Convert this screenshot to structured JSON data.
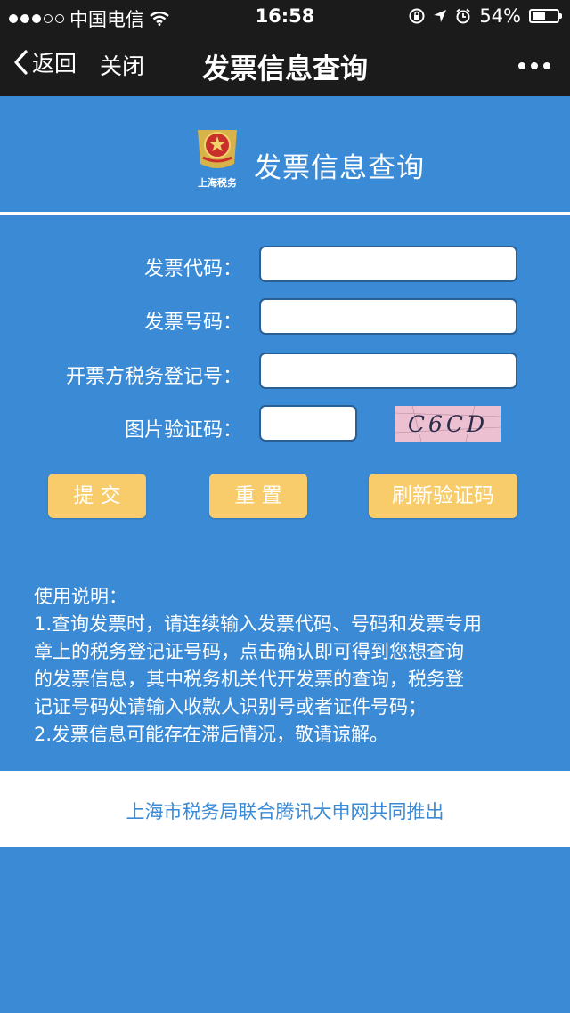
{
  "status_bar": {
    "carrier": "中国电信",
    "time": "16:58",
    "battery_percent": "54%",
    "battery_level": 0.54
  },
  "nav": {
    "back_label": "返回",
    "close_label": "关闭",
    "title": "发票信息查询"
  },
  "header": {
    "emblem_text": "上海税务",
    "title": "发票信息查询"
  },
  "form": {
    "invoice_code_label": "发票代码：",
    "invoice_number_label": "发票号码：",
    "tax_reg_label": "开票方税务登记号：",
    "captcha_label": "图片验证码：",
    "captcha_text": "C6CD"
  },
  "buttons": {
    "submit": "提  交",
    "reset": "重  置",
    "refresh": "刷新验证码"
  },
  "instructions": {
    "title": "使用说明：",
    "lines": [
      "1.查询发票时，请连续输入发票代码、号码和发票专用",
      "章上的税务登记证号码，点击确认即可得到您想查询",
      "的发票信息，其中税务机关代开发票的查询，税务登",
      "记证号码处请输入收款人识别号或者证件号码；",
      "2.发票信息可能存在滞后情况，敬请谅解。"
    ]
  },
  "footer": {
    "text": "上海市税务局联合腾讯大申网共同推出"
  }
}
